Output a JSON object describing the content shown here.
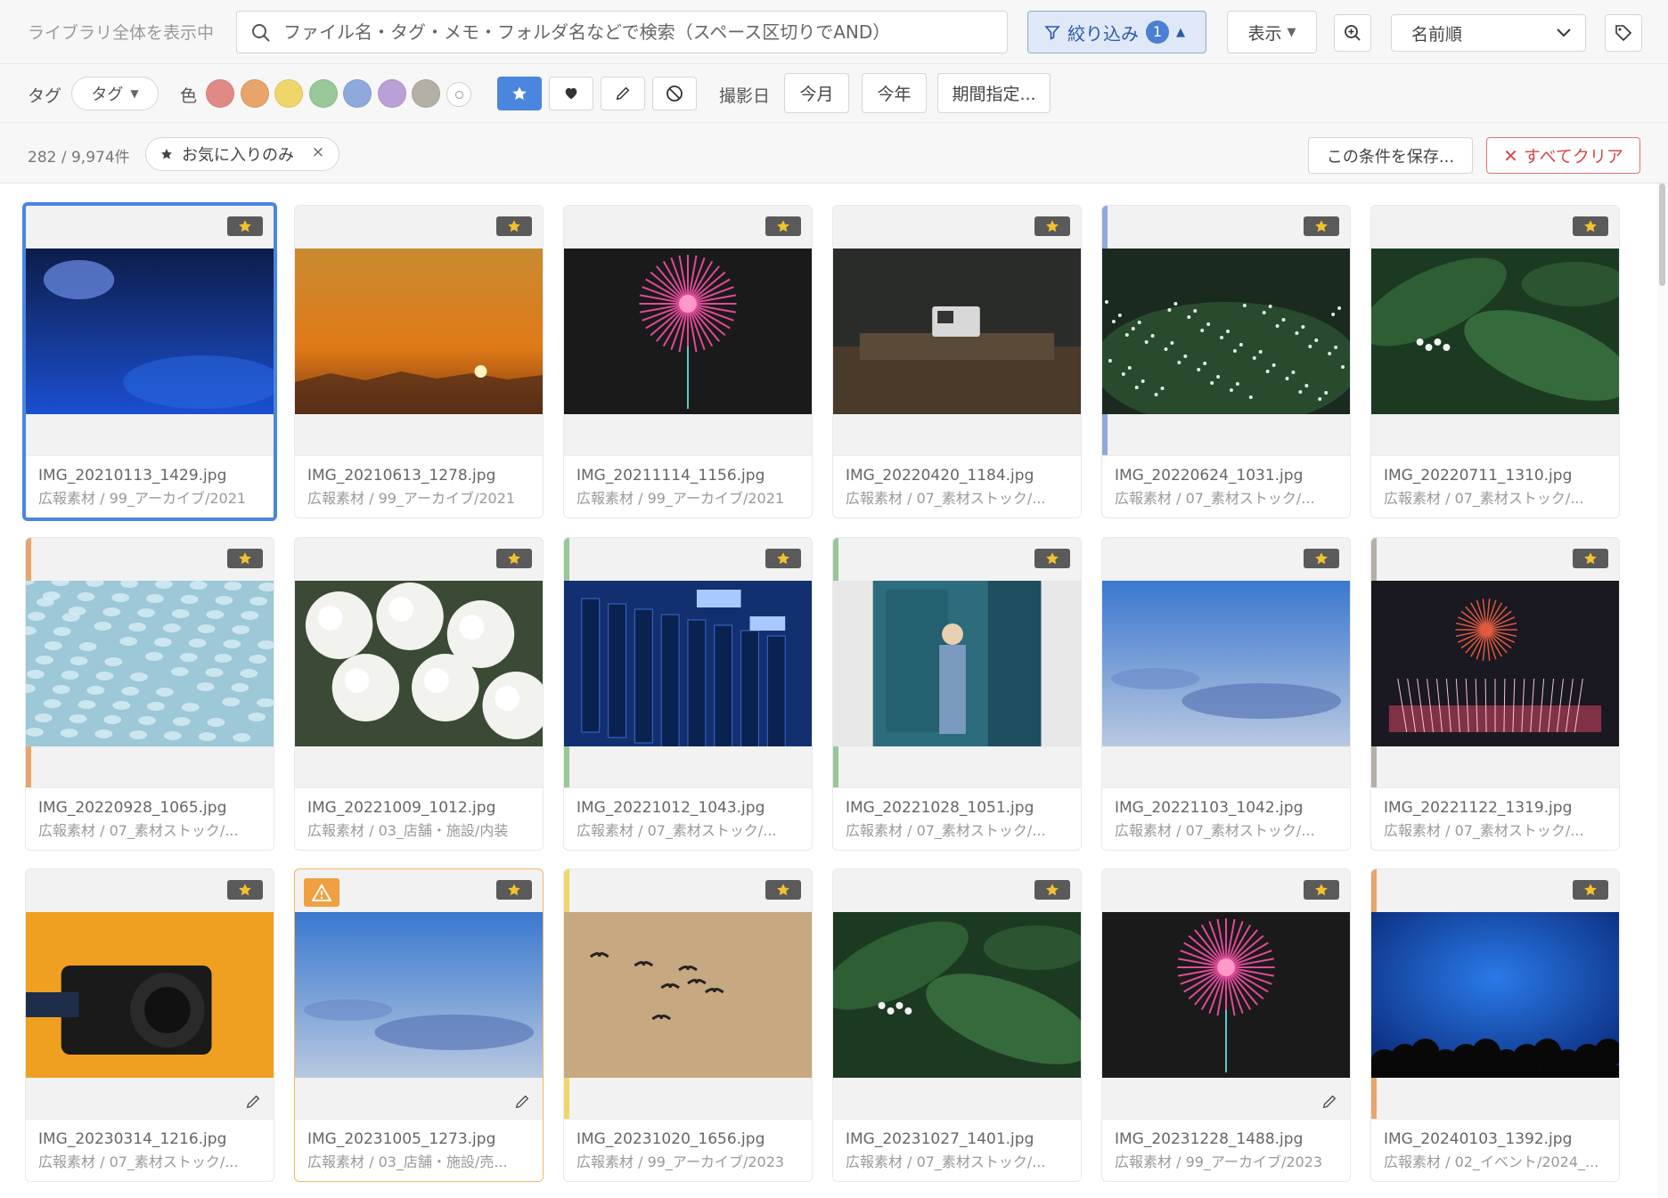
{
  "topbar": {
    "scope_label": "ライブラリ全体を表示中",
    "search_placeholder": "ファイル名・タグ・メモ・フォルダ名などで検索（スペース区切りでAND）",
    "search_value": "",
    "filter_label": "絞り込み",
    "filter_count": "1",
    "view_label": "表示",
    "sort_value": "名前順"
  },
  "filterbar": {
    "tag_label": "タグ",
    "tag_dropdown": "タグ",
    "color_label": "色",
    "colors": [
      "#e08a86",
      "#e8a46a",
      "#efd66a",
      "#98c89a",
      "#8fa9dc",
      "#b9a0d6",
      "#b5b0a6"
    ],
    "date_label": "撮影日",
    "this_month": "今月",
    "this_year": "今年",
    "date_range": "期間指定..."
  },
  "resultbar": {
    "count": "282 / 9,974件",
    "chip_label": "お気に入りのみ",
    "save_label": "この条件を保存...",
    "clear_label": "すべてクリア"
  },
  "cards": [
    {
      "name": "IMG_20210113_1429.jpg",
      "path": "広報素材 / 99_アーカイブ/2021",
      "scene": "bluenight",
      "selected": true
    },
    {
      "name": "IMG_20210613_1278.jpg",
      "path": "広報素材 / 99_アーカイブ/2021",
      "scene": "sunset"
    },
    {
      "name": "IMG_20211114_1156.jpg",
      "path": "広報素材 / 99_アーカイブ/2021",
      "scene": "firework"
    },
    {
      "name": "IMG_20220420_1184.jpg",
      "path": "広報素材 / 07_素材ストック/...",
      "scene": "camerawood"
    },
    {
      "name": "IMG_20220624_1031.jpg",
      "path": "広報素材 / 07_素材ストック/...",
      "scene": "flowersdark",
      "colorbar": "#8fa9dc"
    },
    {
      "name": "IMG_20220711_1310.jpg",
      "path": "広報素材 / 07_素材ストック/...",
      "scene": "leaves"
    },
    {
      "name": "IMG_20220928_1065.jpg",
      "path": "広報素材 / 07_素材ストック/...",
      "scene": "water",
      "colorbar": "#e8a46a"
    },
    {
      "name": "IMG_20221009_1012.jpg",
      "path": "広報素材 / 03_店舗・施設/内装",
      "scene": "hydrangea"
    },
    {
      "name": "IMG_20221012_1043.jpg",
      "path": "広報素材 / 07_素材ストック/...",
      "scene": "servers",
      "colorbar": "#98c89a"
    },
    {
      "name": "IMG_20221028_1051.jpg",
      "path": "広報素材 / 07_素材ストック/...",
      "scene": "person",
      "colorbar": "#98c89a"
    },
    {
      "name": "IMG_20221103_1042.jpg",
      "path": "広報素材 / 07_素材ストック/...",
      "scene": "sky"
    },
    {
      "name": "IMG_20221122_1319.jpg",
      "path": "広報素材 / 07_素材ストック/...",
      "scene": "fireworks2",
      "colorbar": "#b5b0a6"
    },
    {
      "name": "IMG_20230314_1216.jpg",
      "path": "広報素材 / 07_素材ストック/...",
      "scene": "camera",
      "edit": true
    },
    {
      "name": "IMG_20231005_1273.jpg",
      "path": "広報素材 / 03_店舗・施設/売...",
      "scene": "sky",
      "edit": true,
      "warning": true
    },
    {
      "name": "IMG_20231020_1656.jpg",
      "path": "広報素材 / 99_アーカイブ/2023",
      "scene": "birds",
      "colorbar": "#efd66a"
    },
    {
      "name": "IMG_20231027_1401.jpg",
      "path": "広報素材 / 07_素材ストック/...",
      "scene": "leaves"
    },
    {
      "name": "IMG_20231228_1488.jpg",
      "path": "広報素材 / 99_アーカイブ/2023",
      "scene": "firework",
      "edit": true
    },
    {
      "name": "IMG_20240103_1392.jpg",
      "path": "広報素材 / 02_イベント/2024_...",
      "scene": "aquarium",
      "colorbar": "#e8a46a"
    }
  ]
}
